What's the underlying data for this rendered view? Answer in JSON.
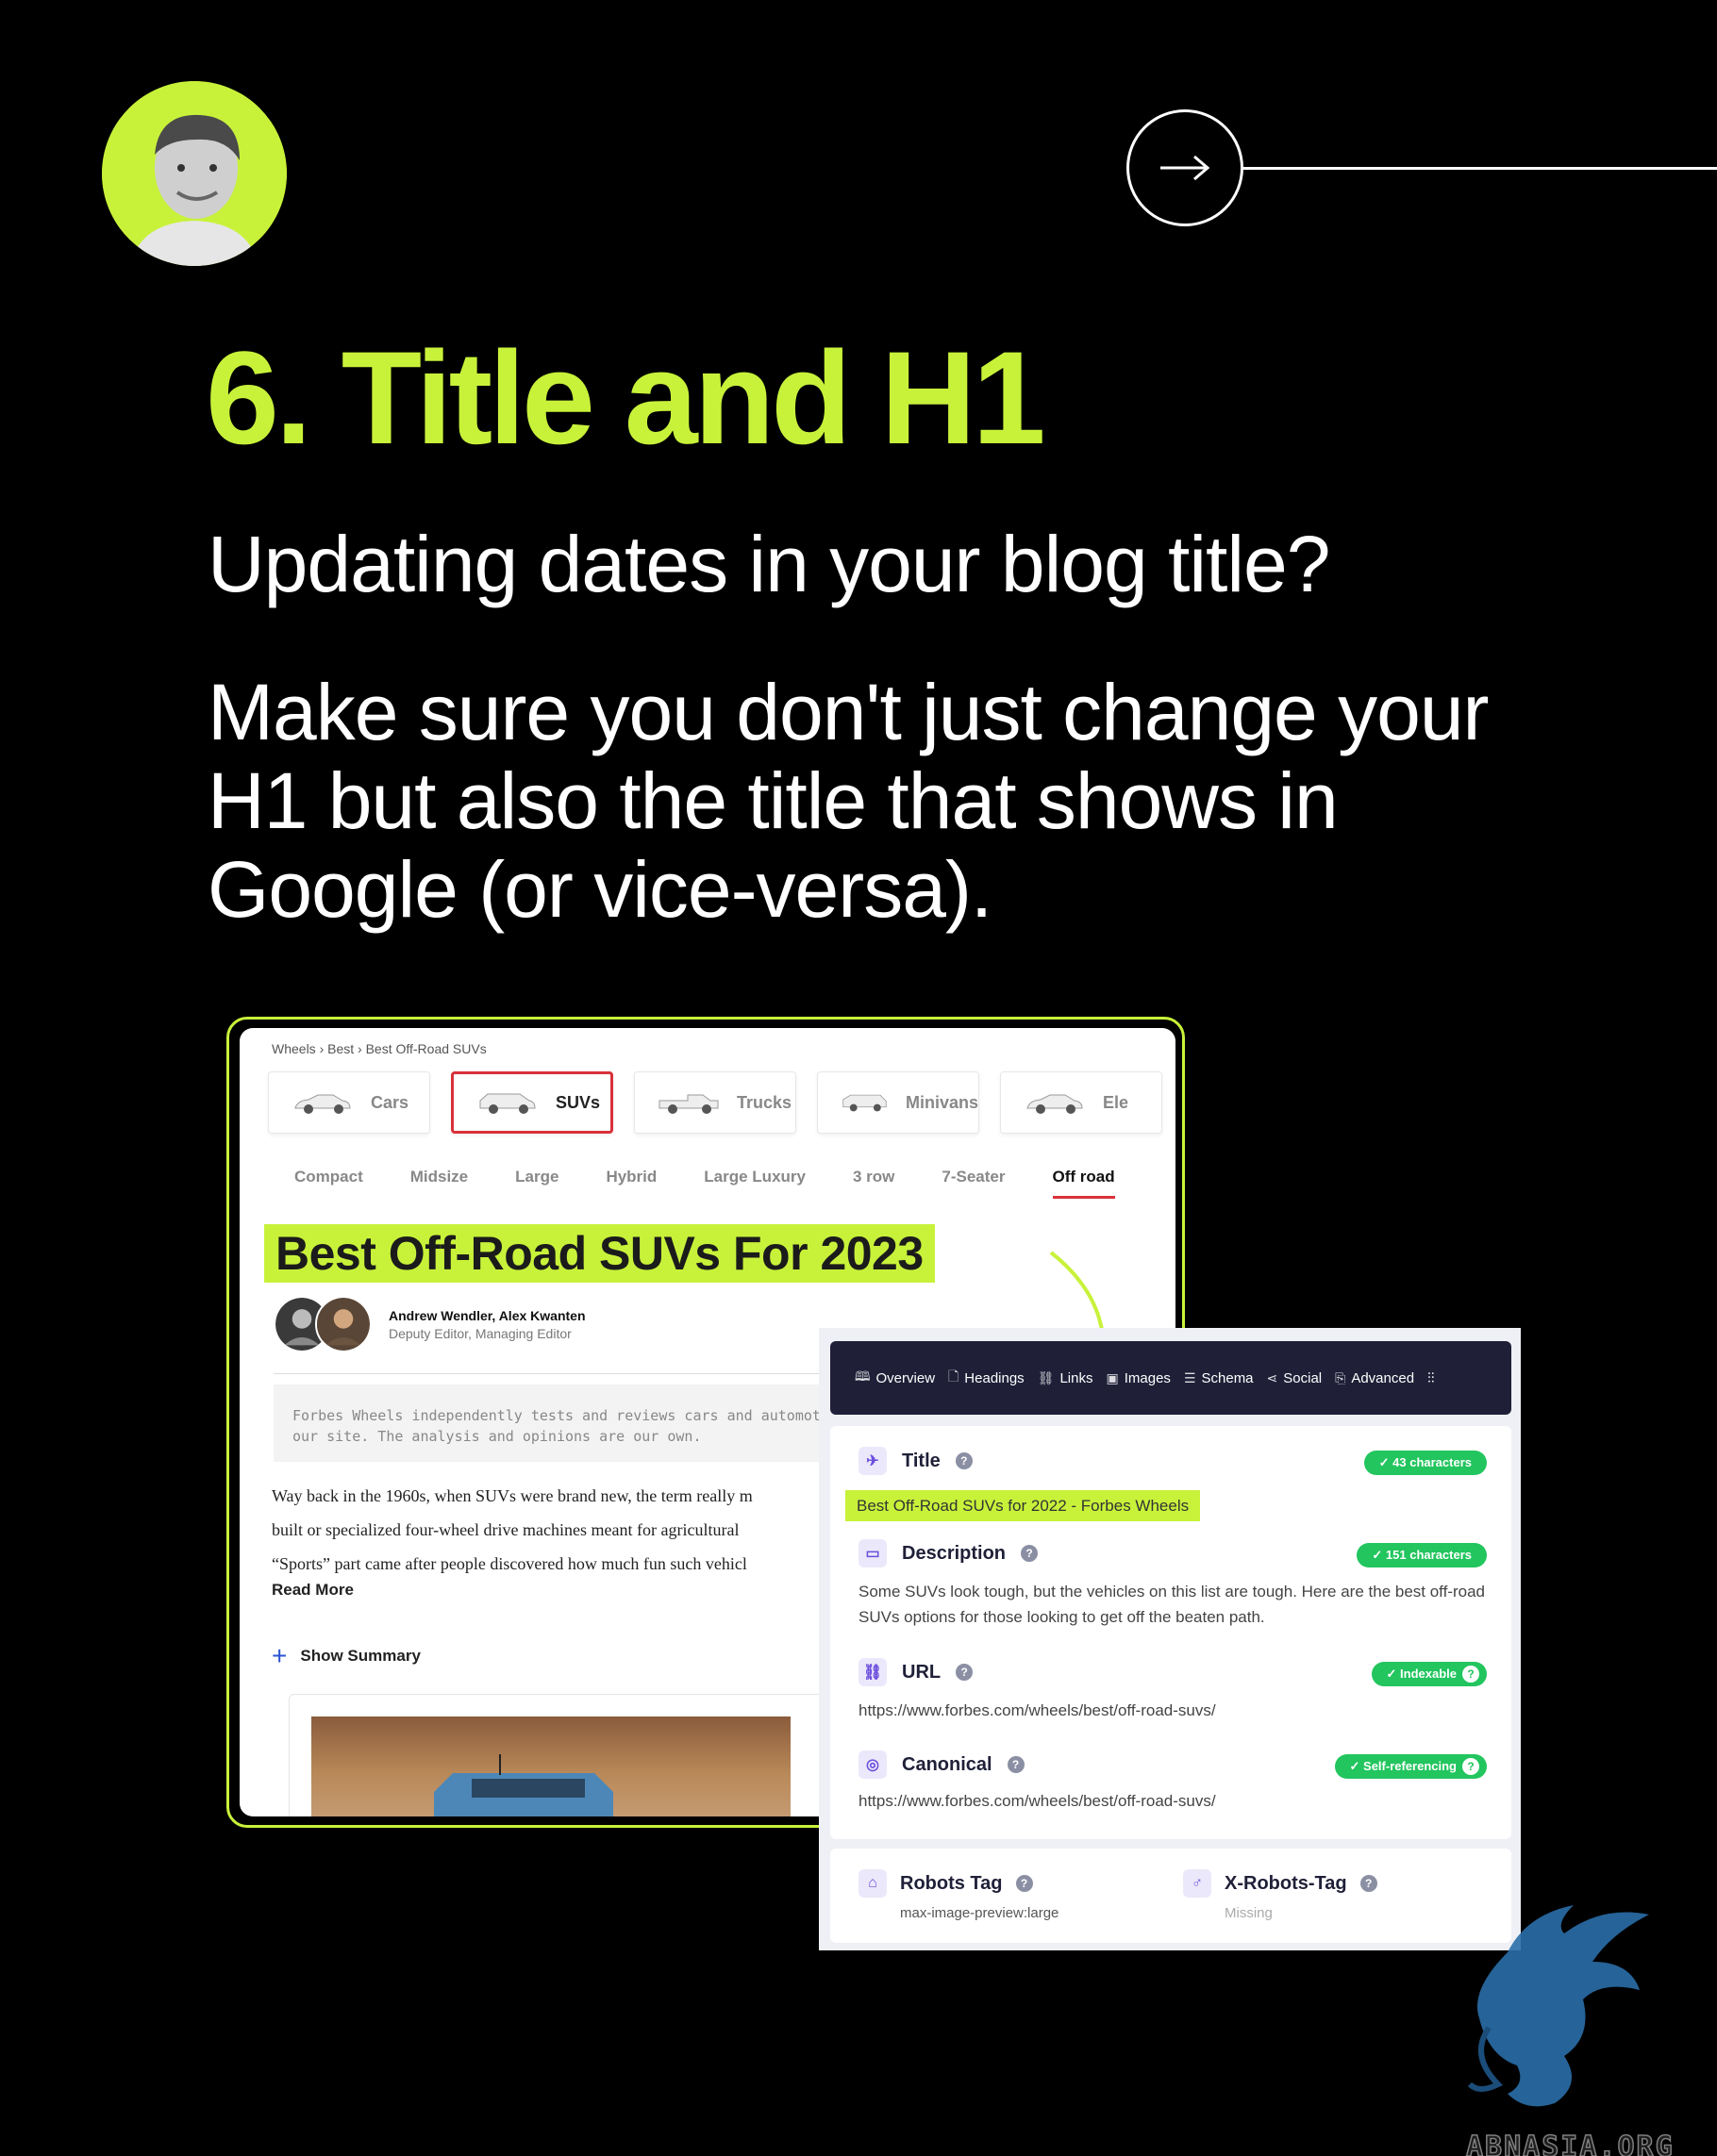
{
  "header": {
    "headline": "6. Title and H1",
    "subline": "Updating dates in your blog title?",
    "body": "Make sure  you don't just change your H1 but also the title that shows in Google (or vice-versa)."
  },
  "article": {
    "breadcrumb": "Wheels  ›  Best  ›  Best Off-Road SUVs",
    "categories": [
      {
        "label": "Cars"
      },
      {
        "label": "SUVs"
      },
      {
        "label": "Trucks"
      },
      {
        "label": "Minivans"
      },
      {
        "label": "Ele"
      }
    ],
    "active_category": "SUVs",
    "subcategories": [
      "Compact",
      "Midsize",
      "Large",
      "Hybrid",
      "Large Luxury",
      "3 row",
      "7-Seater",
      "Off road"
    ],
    "active_subcategory": "Off road",
    "title": "Best Off-Road SUVs For 2023",
    "authors": "Andrew Wendler, Alex Kwanten",
    "roles": "Deputy Editor, Managing Editor",
    "disclaimer": "Forbes Wheels independently tests and reviews cars and automotive our site. The analysis and opinions are our own.",
    "body_lines": [
      "Way back in the 1960s, when SUVs were brand new, the term really m",
      "built or specialized four-wheel drive machines meant for agricultural",
      "“Sports” part came after people discovered how much fun such vehicl"
    ],
    "read_more": "Read More",
    "show_summary": "Show Summary"
  },
  "seo_panel": {
    "tabs": [
      {
        "icon": "book-icon",
        "label": "Overview"
      },
      {
        "icon": "document-icon",
        "label": "Headings"
      },
      {
        "icon": "link-icon",
        "label": "Links"
      },
      {
        "icon": "image-icon",
        "label": "Images"
      },
      {
        "icon": "list-icon",
        "label": "Schema"
      },
      {
        "icon": "share-icon",
        "label": "Social"
      },
      {
        "icon": "advanced-icon",
        "label": "Advanced"
      }
    ],
    "title_label": "Title",
    "title_badge": "✓ 43 characters",
    "title_value": "Best Off-Road SUVs for 2022 - Forbes Wheels",
    "description_label": "Description",
    "description_badge": "✓ 151 characters",
    "description_value": "Some SUVs look tough, but the vehicles on this list are tough. Here are the best off-road SUVs options for those looking to get off the beaten path.",
    "url_label": "URL",
    "url_badge": "✓ Indexable",
    "url_value": "https://www.forbes.com/wheels/best/off-road-suvs/",
    "canonical_label": "Canonical",
    "canonical_badge": "✓ Self-referencing",
    "canonical_value": "https://www.forbes.com/wheels/best/off-road-suvs/",
    "robots_label": "Robots Tag",
    "robots_value": "max-image-preview:large",
    "xrobots_label": "X-Robots-Tag",
    "xrobots_value": "Missing",
    "help_glyph": "?"
  },
  "watermark": "ABNASIA.ORG",
  "colors": {
    "accent": "#c8f23a",
    "background": "#000000",
    "badge_green": "#22c55e",
    "panel_header": "#1f2038",
    "active_red": "#d9313b"
  }
}
